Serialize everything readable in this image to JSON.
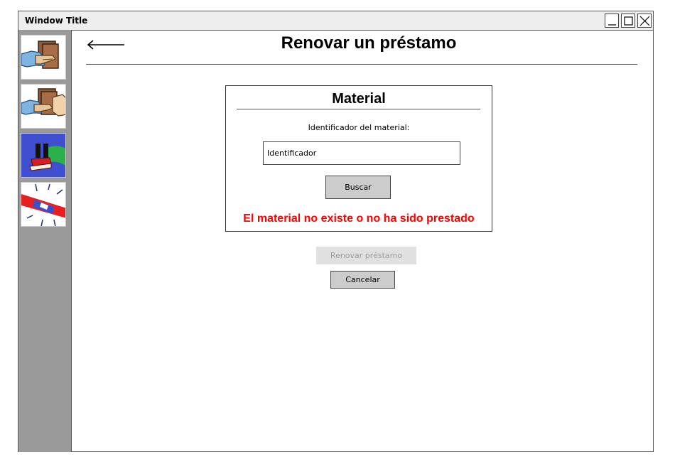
{
  "window": {
    "title": "Window Title",
    "controls": [
      "minimize-icon",
      "maximize-icon",
      "close-icon"
    ]
  },
  "sidebar": {
    "items": [
      {
        "name": "sidebar-item-prestamo",
        "icon": "lend-book-icon"
      },
      {
        "name": "sidebar-item-devolucion",
        "icon": "return-book-icon"
      },
      {
        "name": "sidebar-item-pausa",
        "icon": "pause-book-icon"
      },
      {
        "name": "sidebar-item-alerta",
        "icon": "alert-icon"
      }
    ]
  },
  "header": {
    "back_icon": "back-arrow-icon",
    "title": "Renovar un préstamo"
  },
  "material_panel": {
    "title": "Material",
    "field_label": "Identificador del material:",
    "input_value": "Identificador",
    "search_label": "Buscar",
    "error_message": "El material no existe o no ha sido prestado"
  },
  "actions": {
    "renew_label": "Renovar préstamo",
    "cancel_label": "Cancelar"
  },
  "colors": {
    "error": "#ff0000",
    "sidebar": "#9a9a9a",
    "button": "#cccccc",
    "disabled_button": "#e0e0e0"
  }
}
